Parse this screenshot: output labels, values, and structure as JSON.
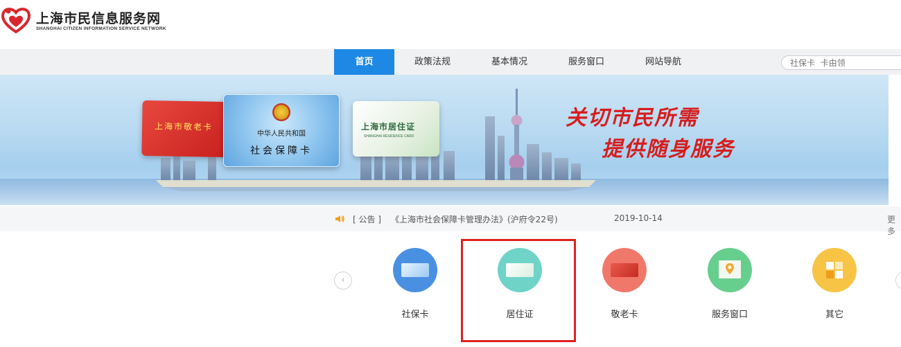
{
  "header": {
    "title": "上海市民信息服务网",
    "subtitle": "SHANGHAI CITIZEN INFORMATION SERVICE NETWORK"
  },
  "nav": {
    "items": [
      {
        "label": "首页",
        "active": true
      },
      {
        "label": "政策法规",
        "active": false
      },
      {
        "label": "基本情况",
        "active": false
      },
      {
        "label": "服务窗口",
        "active": false
      },
      {
        "label": "网站导航",
        "active": false
      }
    ],
    "search_placeholder": "社保卡  卡由领"
  },
  "banner": {
    "card_elderly": "上海市敬老卡",
    "card_social_line1": "中华人民共和国",
    "card_social_line2": "社会保障卡",
    "card_residence": "上海市居住证",
    "card_residence_sub": "SHANGHAI RESIDENCE CARD",
    "slogan_line1": "关切市民所需",
    "slogan_line2": "提供随身服务"
  },
  "notice": {
    "icon": "speaker-icon",
    "tag": "[ 公告 ]",
    "title": "《上海市社会保障卡管理办法》(沪府令22号)",
    "date": "2019-10-14",
    "more": "更多"
  },
  "services": {
    "items": [
      {
        "label": "社保卡",
        "icon": "social-security-card-icon",
        "color": "#4a90e2"
      },
      {
        "label": "居住证",
        "icon": "residence-permit-icon",
        "color": "#6fd3c8"
      },
      {
        "label": "敬老卡",
        "icon": "elderly-card-icon",
        "color": "#f0786b"
      },
      {
        "label": "服务窗口",
        "icon": "service-window-icon",
        "color": "#67cf8d"
      },
      {
        "label": "其它",
        "icon": "other-icon",
        "color": "#f7c445"
      }
    ],
    "prev_arrow": "‹",
    "next_arrow": "›"
  },
  "colors": {
    "nav_active": "#1e88e5",
    "highlight": "#e02020",
    "slogan": "#d71d1d"
  }
}
